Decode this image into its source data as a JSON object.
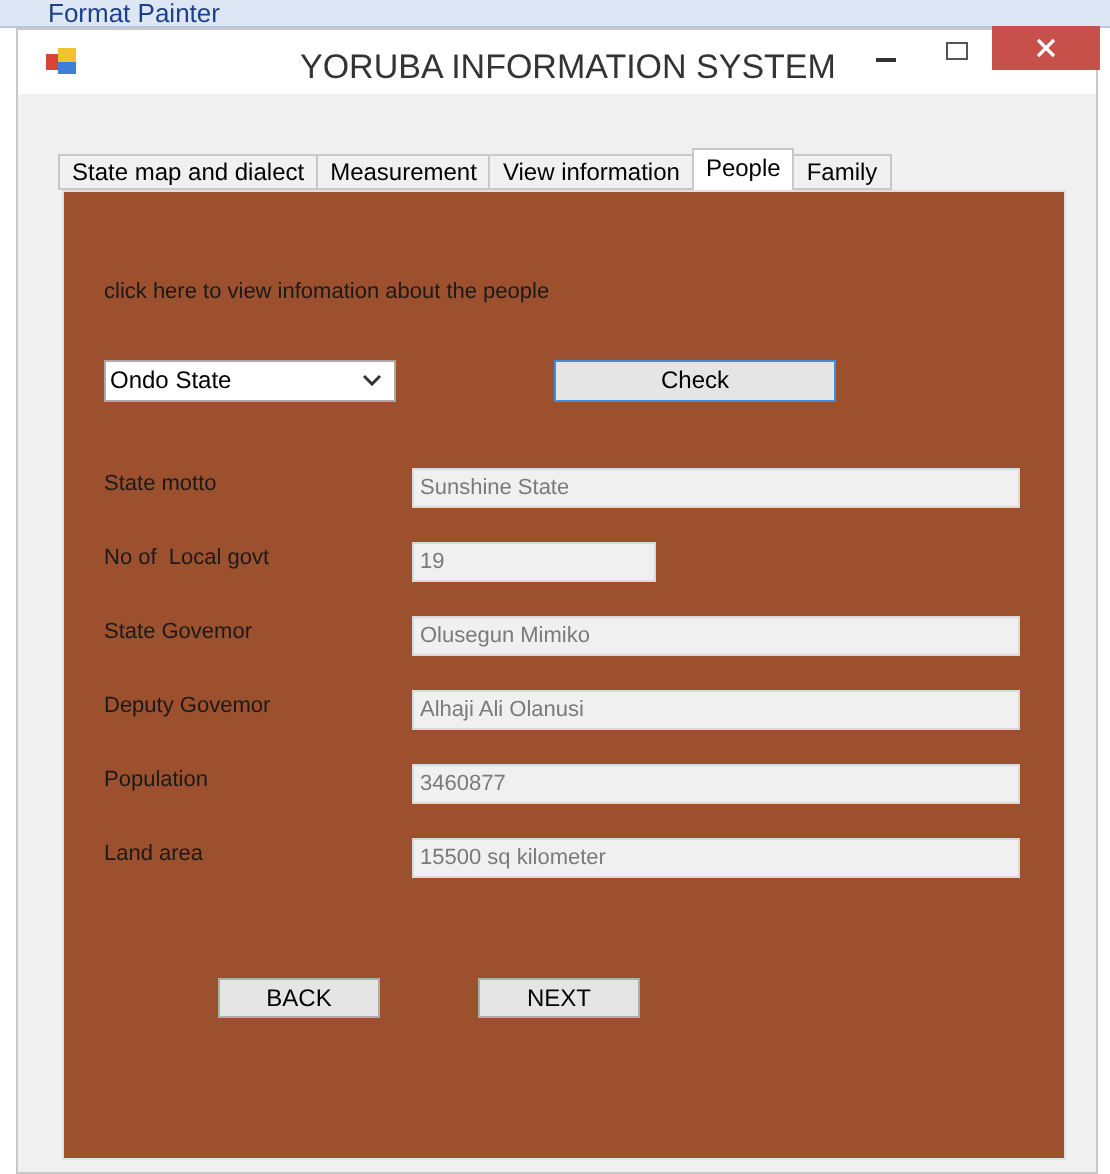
{
  "background_app": {
    "ribbon_text": "Format Painter"
  },
  "window": {
    "title": "YORUBA INFORMATION SYSTEM"
  },
  "tabs": [
    {
      "label": "State map and dialect",
      "selected": false
    },
    {
      "label": "Measurement",
      "selected": false
    },
    {
      "label": "View information",
      "selected": false
    },
    {
      "label": "People",
      "selected": true
    },
    {
      "label": "Family",
      "selected": false
    }
  ],
  "panel": {
    "instruction": "click here to view infomation about the people",
    "state_select": {
      "value": "Ondo State"
    },
    "check_button": "Check",
    "fields": [
      {
        "label": "State motto",
        "value": "Sunshine State",
        "kind": "wide",
        "disabled": true
      },
      {
        "label": "No of  Local govt",
        "value": "19",
        "kind": "narrow",
        "disabled": true
      },
      {
        "label": "State Govemor",
        "value": "Olusegun Mimiko",
        "kind": "wide",
        "disabled": true
      },
      {
        "label": "Deputy Govemor",
        "value": "Alhaji Ali Olanusi",
        "kind": "wide",
        "disabled": true
      },
      {
        "label": "Population",
        "value": "3460877",
        "kind": "wide",
        "disabled": true
      },
      {
        "label": "Land area",
        "value": "15500 sq kilometer",
        "kind": "wide",
        "disabled": true
      }
    ],
    "buttons": [
      "BACK",
      "NEXT"
    ]
  }
}
